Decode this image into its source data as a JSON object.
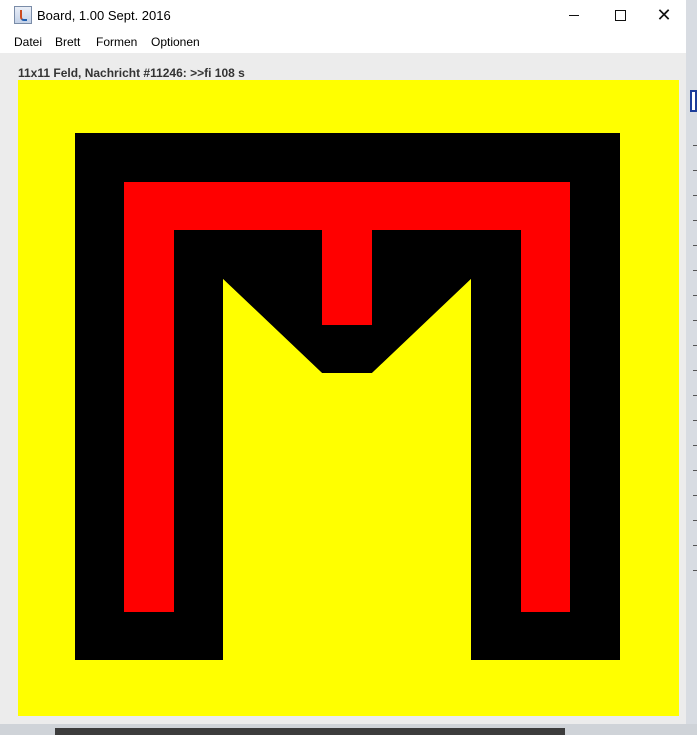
{
  "window": {
    "title": "Board, 1.00 Sept. 2016",
    "icon": "java-app-icon",
    "controls": {
      "minimize": "minimize-icon",
      "maximize": "maximize-icon",
      "close_label": "✕"
    }
  },
  "menu": {
    "items": [
      "Datei",
      "Brett",
      "Formen",
      "Optionen"
    ]
  },
  "status": {
    "text": "11x11 Feld, Nachricht #11246: >>fi 108 s"
  },
  "board": {
    "grid": "11x11",
    "background_color": "#ffff00",
    "shape_colors": {
      "outer": "#000000",
      "inner": "#ff0000"
    }
  }
}
